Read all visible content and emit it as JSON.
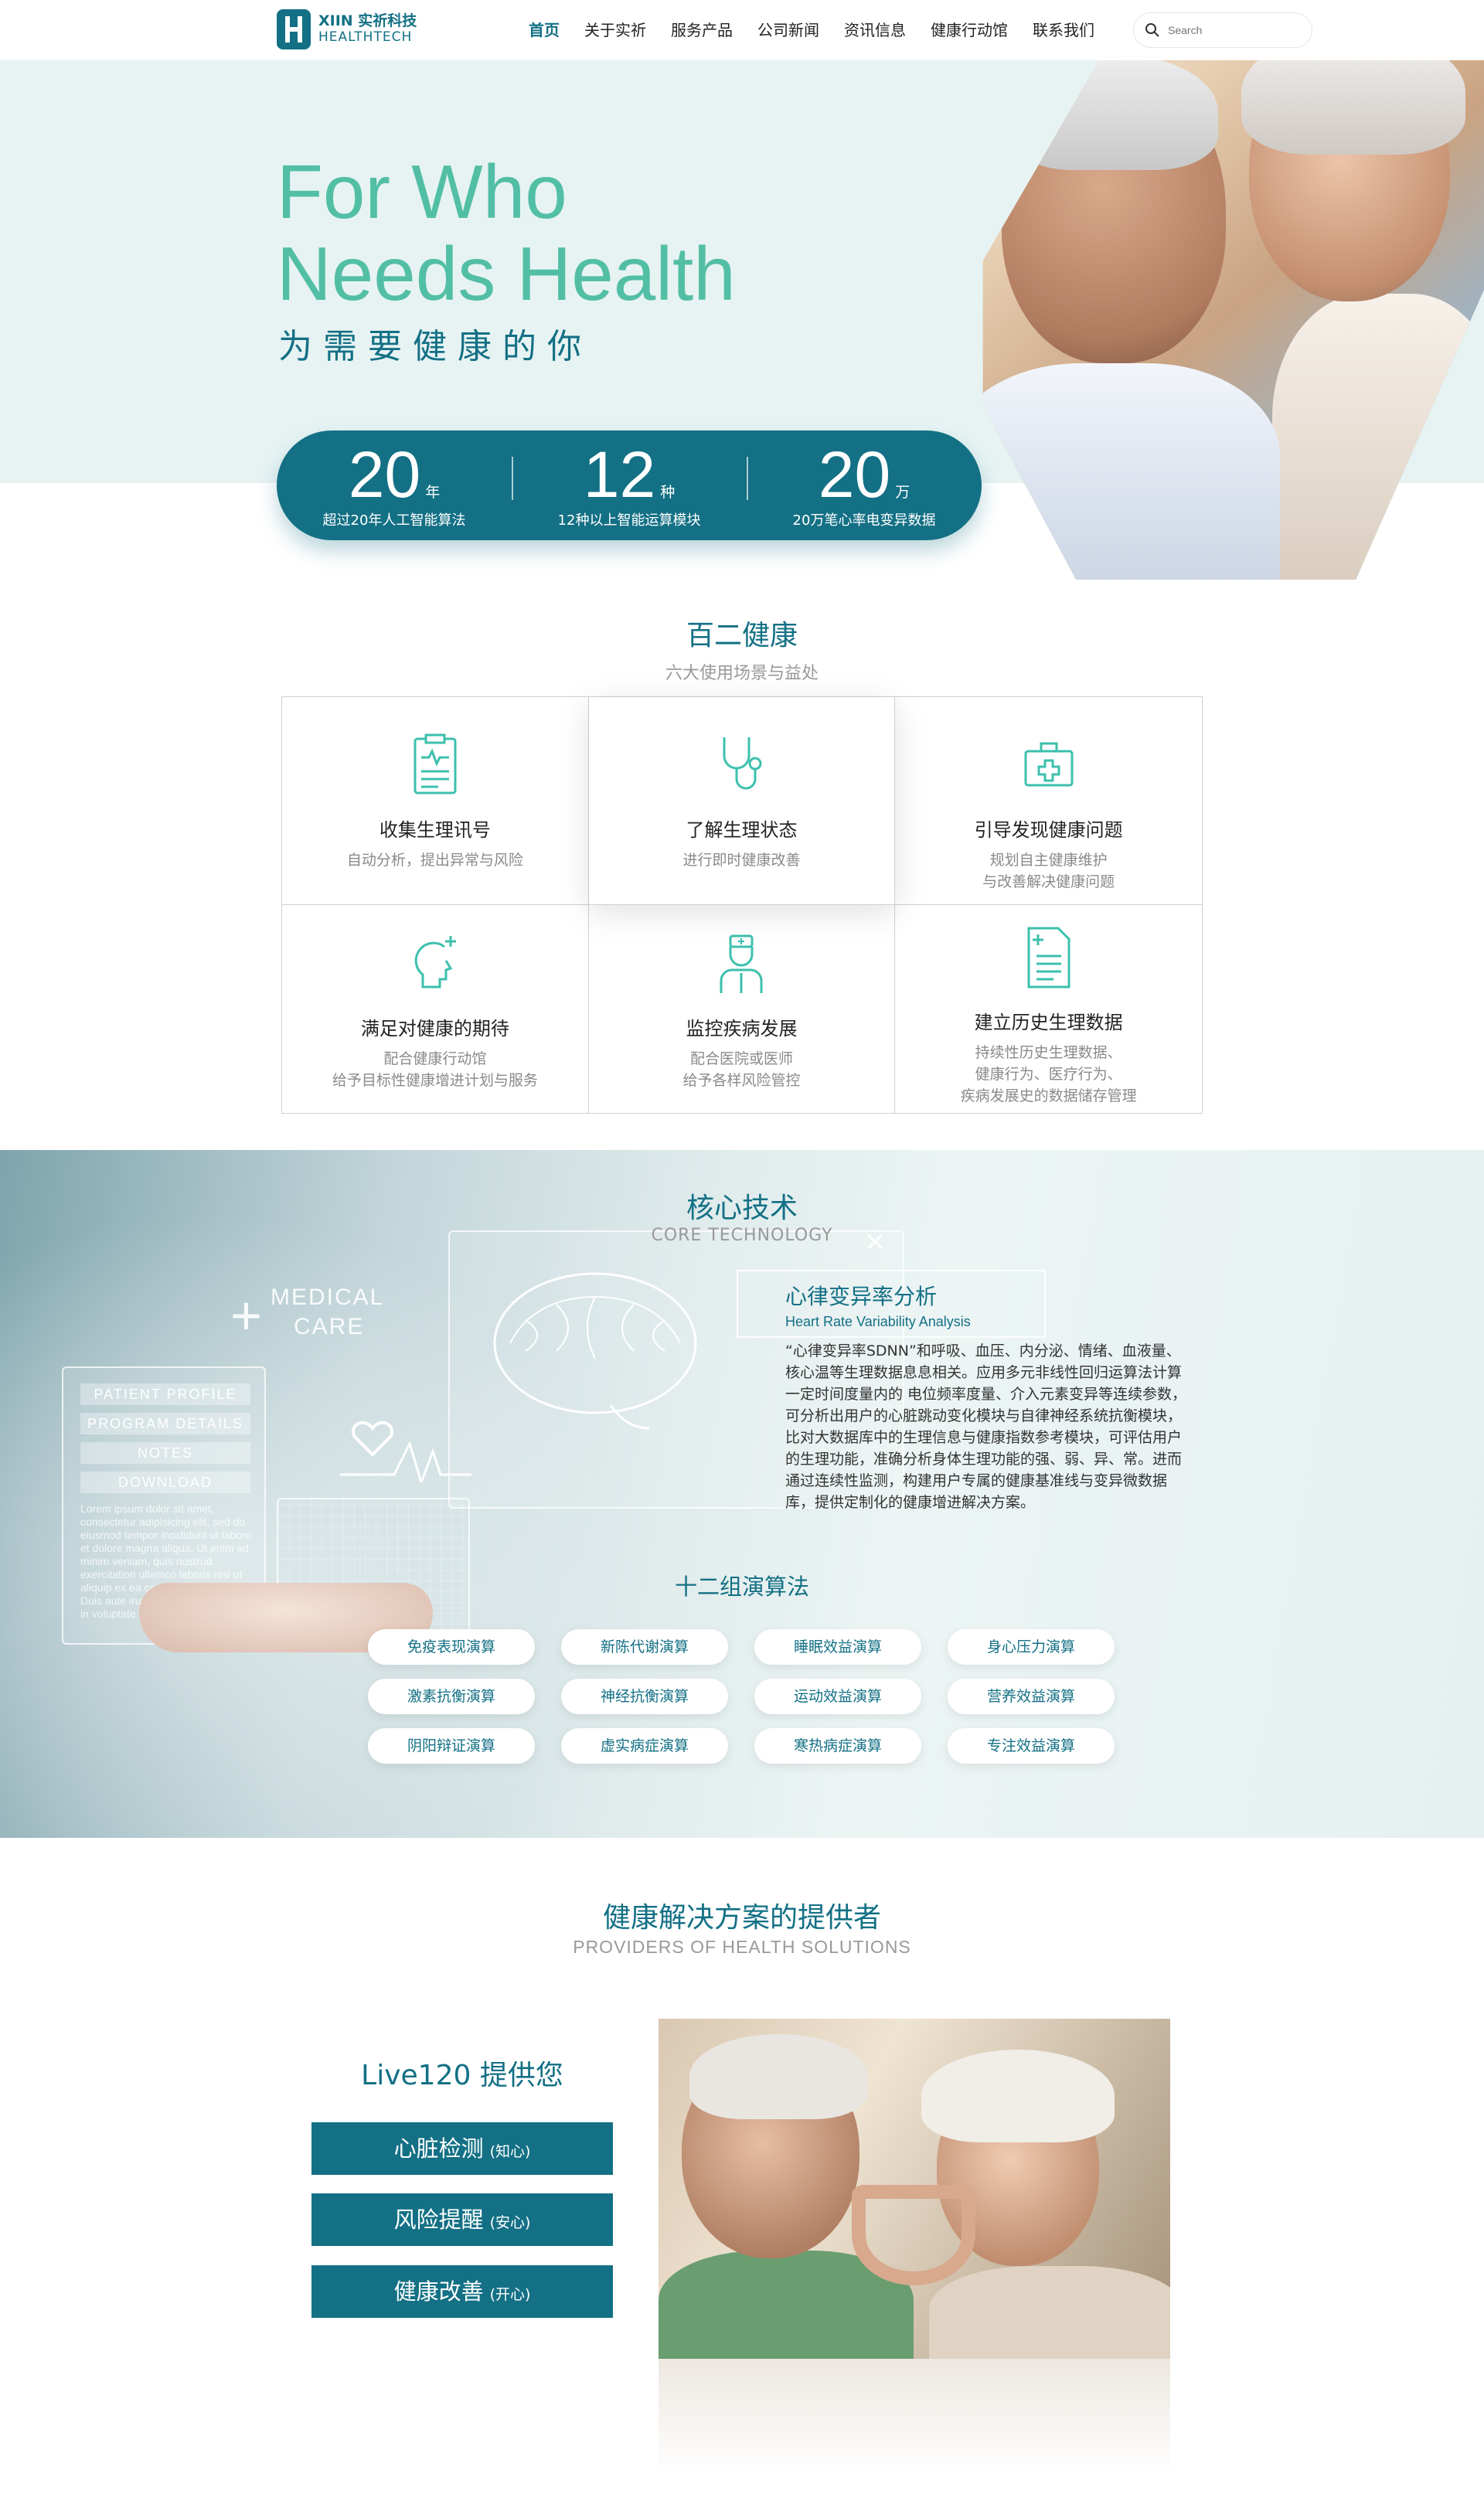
{
  "nav": {
    "logo_line1": "XIIN 实祈科技",
    "logo_line2": "HEALTHTECH",
    "items": [
      {
        "label": "首页",
        "active": true
      },
      {
        "label": "关于实祈",
        "active": false
      },
      {
        "label": "服务产品",
        "active": false
      },
      {
        "label": "公司新闻",
        "active": false
      },
      {
        "label": "资讯信息",
        "active": false
      },
      {
        "label": "健康行动馆",
        "active": false
      },
      {
        "label": "联系我们",
        "active": false
      }
    ],
    "search_placeholder": "Search"
  },
  "hero": {
    "title_line1": "For Who",
    "title_line2": "Needs Health",
    "subtitle": "为需要健康的你"
  },
  "stats": [
    {
      "number": "20",
      "unit": "年",
      "label": "超过20年人工智能算法"
    },
    {
      "number": "12",
      "unit": "种",
      "label": "12种以上智能运算模块"
    },
    {
      "number": "20",
      "unit": "万",
      "label": "20万笔心率电变异数据"
    }
  ],
  "baier": {
    "title": "百二健康",
    "subtitle": "六大使用场景与益处",
    "cards": [
      {
        "icon": "clipboard-pulse-icon",
        "title": "收集生理讯号",
        "desc": "自动分析，提出异常与风险"
      },
      {
        "icon": "stethoscope-icon",
        "title": "了解生理状态",
        "desc": "进行即时健康改善"
      },
      {
        "icon": "medical-kit-icon",
        "title": "引导发现健康问题",
        "desc": "规划自主健康维护\n与改善解决健康问题"
      },
      {
        "icon": "head-plus-icon",
        "title": "满足对健康的期待",
        "desc": "配合健康行动馆\n给予目标性健康增进计划与服务"
      },
      {
        "icon": "doctor-icon",
        "title": "监控疾病发展",
        "desc": "配合医院或医师\n给予各样风险管控"
      },
      {
        "icon": "document-plus-icon",
        "title": "建立历史生理数据",
        "desc": "持续性历史生理数据、\n健康行为、医疗行为、\n疾病发展史的数据储存管理"
      }
    ]
  },
  "core": {
    "title": "核心技术",
    "subtitle": "CORE TECHNOLOGY",
    "holo_medical": "MEDICAL",
    "holo_care": "CARE",
    "holo_buttons": [
      "PATIENT PROFILE",
      "PROGRAM DETAILS",
      "NOTES",
      "DOWNLOAD"
    ],
    "holo_lorem": "Lorem ipsum dolor sit amet, consectetur adipisicing elit, sed do eiusmod tempor incididunt ut labore et dolore magna aliqua. Ut enim ad minim veniam, quis nostrud exercitation ullamco laboris nisi ut aliquip ex ea commodo consequat. Duis aute irure dolor in reprehenderit in voluptate velit esse cillum",
    "hrv_title": "心律变异率分析",
    "hrv_subtitle": "Heart Rate Variability Analysis",
    "hrv_text": "“心律变异率SDNN”和呼吸、血压、内分泌、情绪、血液量、核心温等生理数据息息相关。应用多元非线性回归运算法计算一定时间度量内的  电位频率度量、介入元素变异等连续参数，可分析出用户的心脏跳动变化模块与自律神经系统抗衡模块，比对大数据库中的生理信息与健康指数参考模块，可评估用户的生理功能，准确分析身体生理功能的强、弱、异、常。进而通过连续性监测，构建用户专属的健康基准线与变异微数据库，提供定制化的健康增进解决方案。",
    "algo_title": "十二组演算法",
    "algorithms": [
      "免疫表现演算",
      "新陈代谢演算",
      "睡眠效益演算",
      "身心压力演算",
      "激素抗衡演算",
      "神经抗衡演算",
      "运动效益演算",
      "营养效益演算",
      "阴阳辩证演算",
      "虚实病症演算",
      "寒热病症演算",
      "专注效益演算"
    ]
  },
  "providers": {
    "title": "健康解决方案的提供者",
    "subtitle": "PROVIDERS OF HEALTH SOLUTIONS",
    "live_title": "Live120 提供您",
    "buttons": [
      {
        "label": "心脏检测",
        "note": "(知心)"
      },
      {
        "label": "风险提醒",
        "note": "(安心)"
      },
      {
        "label": "健康改善",
        "note": "(开心)"
      }
    ]
  },
  "colors": {
    "primary": "#137085",
    "accent": "#52bfa5",
    "hero_bg": "#e7f3f3"
  }
}
